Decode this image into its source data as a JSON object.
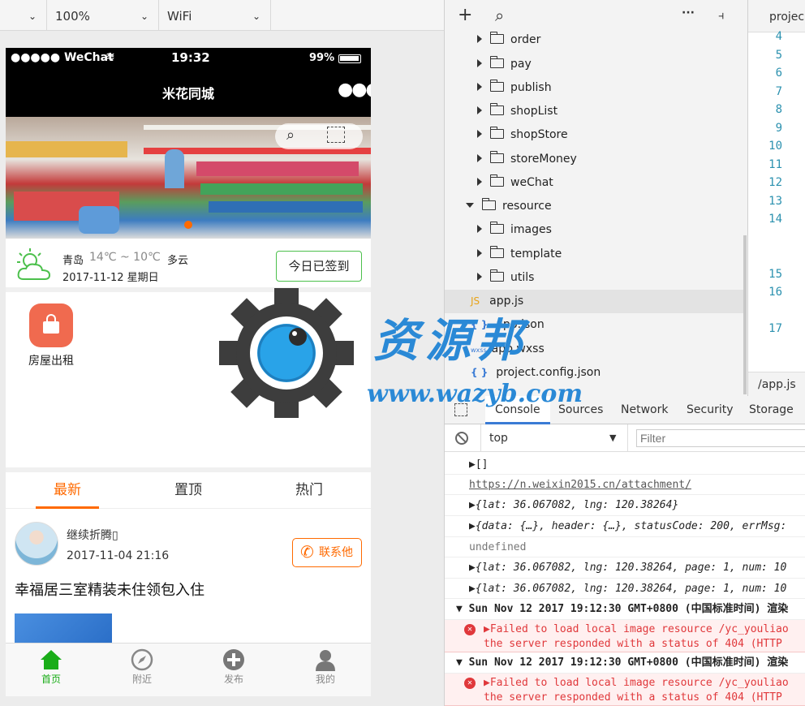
{
  "toolbar": {
    "device_value": "",
    "zoom_value": "100%",
    "network_value": "WiFi"
  },
  "phone": {
    "status": {
      "carrier": "●●●●● WeChat",
      "time": "19:32",
      "battery": "99%"
    },
    "nav_title": "米花同城",
    "weather": {
      "city": "青岛",
      "temp": "14℃ ~ 10℃",
      "condition": "多云",
      "date": "2017-11-12 星期日",
      "checkin_label": "今日已签到"
    },
    "grid_items": [
      {
        "label": "房屋出租",
        "icon": "lock-icon",
        "color": "#f06a4f"
      }
    ],
    "tabs": [
      {
        "label": "最新",
        "active": true
      },
      {
        "label": "置顶",
        "active": false
      },
      {
        "label": "热门",
        "active": false
      }
    ],
    "post": {
      "author": "继续折腾▯",
      "time": "2017-11-04 21:16",
      "contact_label": "联系他",
      "title": "幸福居三室精装未住领包入住"
    },
    "tabbar": [
      {
        "label": "首页",
        "icon": "home-icon",
        "active": true
      },
      {
        "label": "附近",
        "icon": "compass-icon",
        "active": false
      },
      {
        "label": "发布",
        "icon": "plus-circle-icon",
        "active": false
      },
      {
        "label": "我的",
        "icon": "user-icon",
        "active": false
      }
    ]
  },
  "filetree": {
    "items": [
      {
        "label": "order",
        "type": "folder",
        "expanded": false
      },
      {
        "label": "pay",
        "type": "folder",
        "expanded": false
      },
      {
        "label": "publish",
        "type": "folder",
        "expanded": false
      },
      {
        "label": "shopList",
        "type": "folder",
        "expanded": false
      },
      {
        "label": "shopStore",
        "type": "folder",
        "expanded": false
      },
      {
        "label": "storeMoney",
        "type": "folder",
        "expanded": false
      },
      {
        "label": "weChat",
        "type": "folder",
        "expanded": false
      },
      {
        "label": "resource",
        "type": "folder",
        "expanded": true
      },
      {
        "label": "images",
        "type": "folder",
        "expanded": false
      },
      {
        "label": "template",
        "type": "folder",
        "expanded": false
      },
      {
        "label": "utils",
        "type": "folder",
        "expanded": false
      },
      {
        "label": "app.js",
        "type": "js",
        "badge": "JS",
        "selected": true
      },
      {
        "label": "app.json",
        "type": "json",
        "badge": "{ }"
      },
      {
        "label": "app.wxss",
        "type": "wxss",
        "badge": "wxss"
      },
      {
        "label": "project.config.json",
        "type": "json",
        "badge": "{ }"
      }
    ]
  },
  "editor": {
    "tab_label": "projec",
    "line_numbers": [
      "4",
      "5",
      "6",
      "7",
      "8",
      "9",
      "10",
      "11",
      "12",
      "13",
      "14",
      "15",
      "16",
      "17"
    ],
    "footer_path": "/app.js"
  },
  "devtools": {
    "tabs": [
      "Console",
      "Sources",
      "Network",
      "Security",
      "Storage"
    ],
    "active_tab": "Console",
    "context": "top",
    "filter_placeholder": "Filter",
    "lines": [
      {
        "text": "▶[]",
        "kind": "log"
      },
      {
        "text": "https://n.weixin2015.cn/attachment/",
        "kind": "link"
      },
      {
        "text": "▶{lat: 36.067082, lng: 120.38264}",
        "kind": "log"
      },
      {
        "text": "▶{data: {…}, header: {…}, statusCode: 200, errMsg:",
        "kind": "log"
      },
      {
        "text": "undefined",
        "kind": "muted"
      },
      {
        "text": "▶{lat: 36.067082, lng: 120.38264, page: 1, num: 10",
        "kind": "log"
      },
      {
        "text": "▶{lat: 36.067082, lng: 120.38264, page: 1, num: 10",
        "kind": "log"
      },
      {
        "text": "Sun Nov 12 2017 19:12:30 GMT+0800 (中国标准时间) 渲染",
        "kind": "group"
      },
      {
        "text": "▶Failed to load local image resource /yc_youliao",
        "text2": "the server responded with a status of 404 (HTTP",
        "kind": "error"
      },
      {
        "text": "Sun Nov 12 2017 19:12:30 GMT+0800 (中国标准时间) 渲染",
        "kind": "group"
      },
      {
        "text": "▶Failed to load local image resource /yc_youliao",
        "text2": "the server responded with a status of 404 (HTTP",
        "kind": "error"
      }
    ]
  },
  "watermark": {
    "title": "资源邦",
    "url": "www.wazyb.com"
  }
}
